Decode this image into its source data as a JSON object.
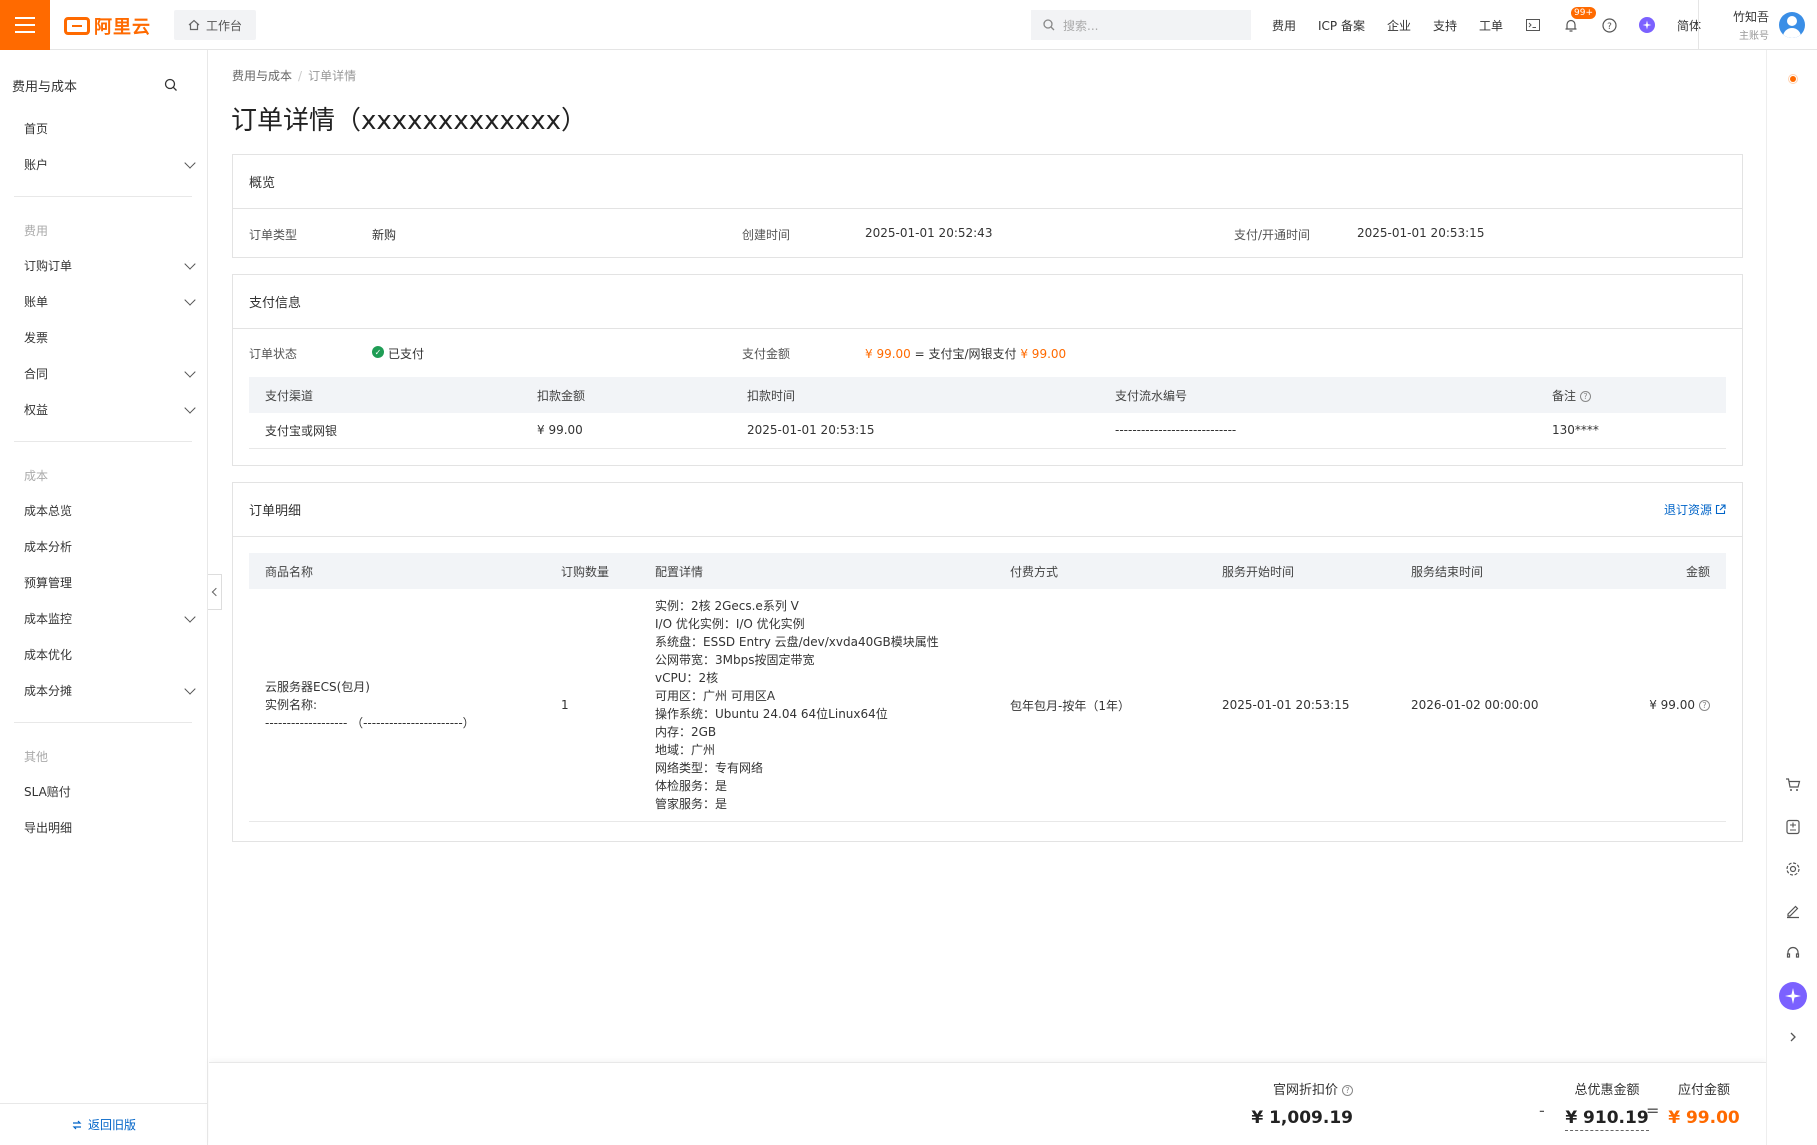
{
  "topbar": {
    "logo_text": "阿里云",
    "workbench": "工作台",
    "search_placeholder": "搜索...",
    "links": [
      "费用",
      "ICP 备案",
      "企业",
      "支持",
      "工单"
    ],
    "notification_badge": "99+",
    "language": "简体",
    "user_name": "竹知吾",
    "user_role": "主账号"
  },
  "sidebar": {
    "title": "费用与成本",
    "items": [
      {
        "label": "首页",
        "chevron": false
      },
      {
        "label": "账户",
        "chevron": true
      }
    ],
    "group_cost_fee": "费用",
    "fee_items": [
      {
        "label": "订购订单",
        "chevron": true
      },
      {
        "label": "账单",
        "chevron": true
      },
      {
        "label": "发票",
        "chevron": false
      },
      {
        "label": "合同",
        "chevron": true
      },
      {
        "label": "权益",
        "chevron": true
      }
    ],
    "group_cost": "成本",
    "cost_items": [
      {
        "label": "成本总览",
        "chevron": false
      },
      {
        "label": "成本分析",
        "chevron": false
      },
      {
        "label": "预算管理",
        "chevron": false
      },
      {
        "label": "成本监控",
        "chevron": true
      },
      {
        "label": "成本优化",
        "chevron": false
      },
      {
        "label": "成本分摊",
        "chevron": true
      }
    ],
    "group_other": "其他",
    "other_items": [
      {
        "label": "SLA赔付",
        "chevron": false
      },
      {
        "label": "导出明细",
        "chevron": false
      }
    ],
    "back_label": "返回旧版"
  },
  "breadcrumb": {
    "parent": "费用与成本",
    "current": "订单详情"
  },
  "page_title": "订单详情（xxxxxxxxxxxxx）",
  "overview": {
    "title": "概览",
    "order_type_label": "订单类型",
    "order_type": "新购",
    "created_label": "创建时间",
    "created": "2025-01-01 20:52:43",
    "paid_label": "支付/开通时间",
    "paid": "2025-01-01 20:53:15"
  },
  "payment": {
    "title": "支付信息",
    "status_label": "订单状态",
    "status": "已支付",
    "amount_label": "支付金额",
    "amount_value": "¥ 99.00",
    "amount_mid": " = 支付宝/网银支付 ",
    "amount_value2": "¥ 99.00",
    "columns": [
      "支付渠道",
      "扣款金额",
      "扣款时间",
      "支付流水编号",
      "备注"
    ],
    "rows": [
      [
        "支付宝或网银",
        "¥ 99.00",
        "2025-01-01 20:53:15",
        "----------------------------",
        "130****"
      ]
    ]
  },
  "details": {
    "title": "订单明细",
    "refund_link": "退订资源",
    "columns": [
      "商品名称",
      "订购数量",
      "配置详情",
      "付费方式",
      "服务开始时间",
      "服务结束时间",
      "金额"
    ],
    "product_name": [
      "云服务器ECS(包月)",
      "实例名称:",
      "------------------- （-----------------------）"
    ],
    "quantity": "1",
    "config": [
      "实例：2核 2Gecs.e系列 V",
      "I/O 优化实例：I/O 优化实例",
      "系统盘：ESSD Entry 云盘/dev/xvda40GB模块属性",
      "公网带宽：3Mbps按固定带宽",
      "vCPU：2核",
      "可用区：广州 可用区A",
      "操作系统：Ubuntu 24.04 64位Linux64位",
      "内存：2GB",
      "地域：广州",
      "网络类型：专有网络",
      "体检服务：是",
      "管家服务：是"
    ],
    "billing": "包年包月-按年（1年）",
    "start": "2025-01-01 20:53:15",
    "end": "2026-01-02 00:00:00",
    "amount": "¥ 99.00"
  },
  "footer": {
    "list_price_label": "官网折扣价",
    "list_price": "¥ 1,009.19",
    "minus": "-",
    "discount_label": "总优惠金额",
    "discount": "¥ 910.19",
    "equals": "=",
    "payable_label": "应付金额",
    "payable": "¥ 99.00"
  },
  "colors": {
    "accent": "#ff6a00",
    "link": "#0064c8",
    "success": "#1f9d55"
  }
}
